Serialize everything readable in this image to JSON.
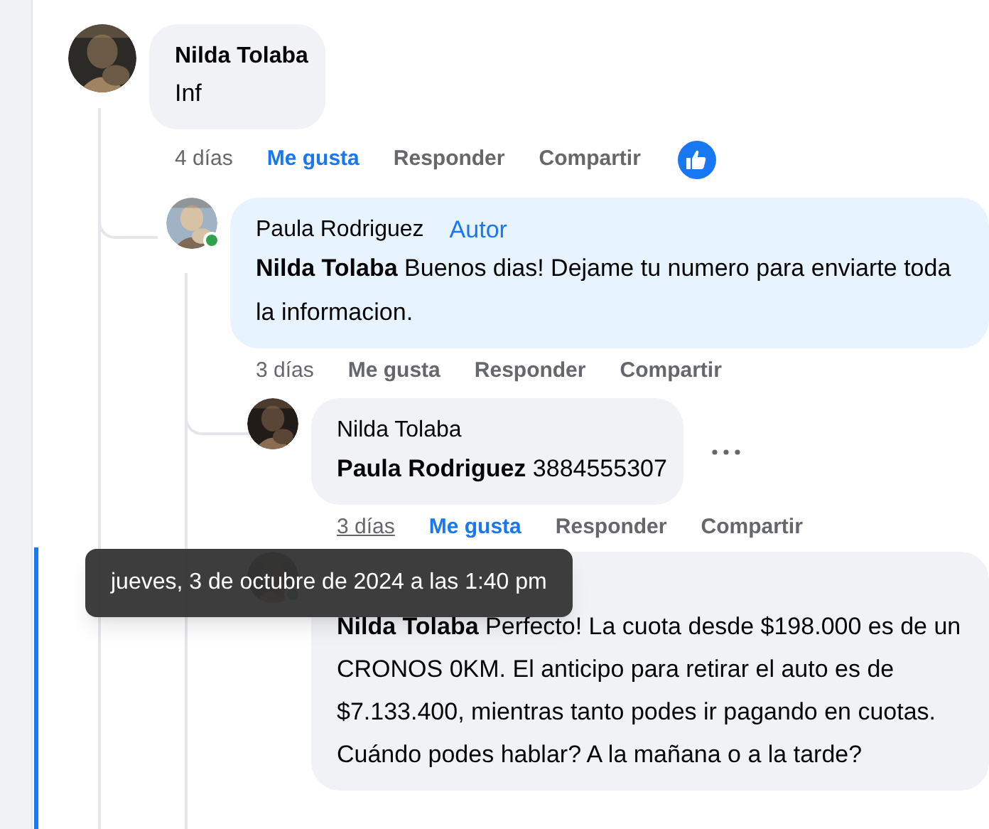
{
  "comments": [
    {
      "author": "Nilda Tolaba",
      "text": "Inf",
      "time": "4 días",
      "like_label": "Me gusta",
      "liked": true,
      "reply_label": "Responder",
      "share_label": "Compartir",
      "has_reaction": true,
      "replies": [
        {
          "author": "Paula Rodriguez",
          "author_badge": "Autor",
          "mention": "Nilda Tolaba",
          "text": "Buenos dias! Dejame tu numero para enviarte toda la informacion.",
          "online": true,
          "time": "3 días",
          "like_label": "Me gusta",
          "liked": false,
          "reply_label": "Responder",
          "share_label": "Compartir",
          "replies": [
            {
              "author": "Nilda Tolaba",
              "mention": "Paula Rodriguez",
              "text": "3884555307",
              "time": "3 días",
              "time_hovered": true,
              "like_label": "Me gusta",
              "liked": true,
              "reply_label": "Responder",
              "share_label": "Compartir",
              "more_menu": true
            },
            {
              "mention": "Nilda Tolaba",
              "text": "Perfecto! La cuota desde $198.000 es de un CRONOS 0KM. El anticipo para retirar el auto es de $7.133.400, mientras tanto podes ir pagando en cuotas. Cuándo podes hablar? A la mañana o a la tarde?",
              "online": true,
              "highlighted": true
            }
          ]
        }
      ]
    }
  ],
  "tooltip": {
    "text": "jueves, 3 de octubre de 2024 a las 1:40 pm"
  }
}
